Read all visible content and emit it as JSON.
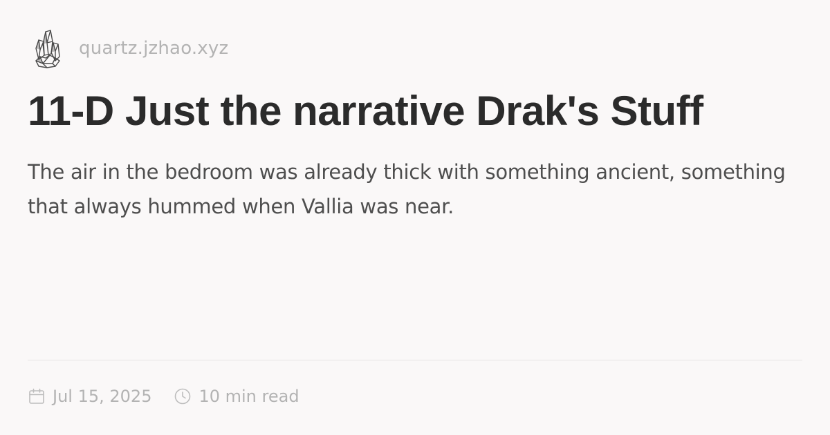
{
  "site": {
    "logo_icon": "crystal-logo-icon",
    "url": "quartz.jzhao.xyz"
  },
  "article": {
    "title": "11-D Just the narrative Drak's Stuff",
    "description": "The air in the bedroom was already thick with something ancient, something that always hummed when Vallia was near."
  },
  "meta": {
    "date_icon": "calendar-icon",
    "date": "Jul 15, 2025",
    "reading_icon": "clock-icon",
    "reading_time": "10 min read"
  },
  "colors": {
    "background": "#faf8f8",
    "title": "#2b2b2b",
    "text": "#4e4e4e",
    "muted": "#b3b3b3",
    "divider": "#e6e4e4"
  }
}
